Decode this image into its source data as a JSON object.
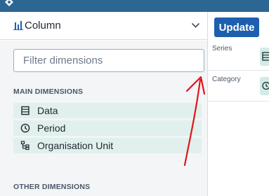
{
  "left_panel": {
    "visualization_type": "Column",
    "filter_placeholder": "Filter dimensions",
    "main_dimensions_title": "MAIN DIMENSIONS",
    "main_dimensions": [
      {
        "label": "Data",
        "icon": "data-icon"
      },
      {
        "label": "Period",
        "icon": "period-clock-icon"
      },
      {
        "label": "Organisation Unit",
        "icon": "org-unit-icon"
      }
    ],
    "other_dimensions_title": "OTHER DIMENSIONS"
  },
  "toolbar": {
    "update_label": "Update"
  },
  "layout": {
    "series_label": "Series",
    "category_label": "Category"
  },
  "colors": {
    "header_bg": "#2c6693",
    "accent": "#1d5fae",
    "dimension_item_bg": "#e1f0ec",
    "annotation_arrow": "#e0141e"
  }
}
